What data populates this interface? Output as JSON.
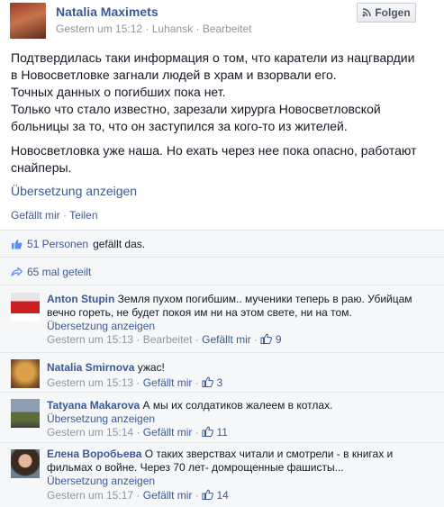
{
  "post": {
    "author": "Natalia Maximets",
    "time": "Gestern um 15:12",
    "sep": "·",
    "location": "Luhansk",
    "edited": "Bearbeitet",
    "follow_label": "Folgen",
    "body_lines": [
      "Подтвердилась таки информация о том, что каратели из нацгвардии",
      "в Новосветловке загнали людей в храм и взорвали его.",
      "Точных данных о погибших пока нет.",
      "Только что стало известно, зарезали хирурга Новосветловской",
      "больницы за то, что он заступился за кого-то из жителей."
    ],
    "body_lines_2": [
      "Новосветловка уже наша. Но ехать через нее пока опасно, работают",
      "снайперы."
    ],
    "translate_label": "Übersetzung anzeigen",
    "like_label": "Gefällt mir",
    "share_label": "Teilen"
  },
  "ufi": {
    "likes_link": "51 Personen",
    "likes_suffix": "gefällt das.",
    "shares_label": "65 mal geteilt"
  },
  "comments": [
    {
      "name": "Anton Stupin",
      "text_line1": "Земля пухом погибшим.. мученики теперь в раю. Убийцам",
      "text_line2": "вечно гореть, не будет покоя им ни на этом свете, ни на том.",
      "translate": "Übersetzung anzeigen",
      "time": "Gestern um 15:13",
      "edited": "Bearbeitet",
      "like": "Gefällt mir",
      "count": "9"
    },
    {
      "name": "Natalia Smirnova",
      "text_line1": "ужас!",
      "time": "Gestern um 15:13",
      "like": "Gefällt mir",
      "count": "3"
    },
    {
      "name": "Tatyana Makarova",
      "text_line1": "А мы их солдатиков жалеем в котлах.",
      "translate": "Übersetzung anzeigen",
      "time": "Gestern um 15:14",
      "like": "Gefällt mir",
      "count": "11"
    },
    {
      "name": "Елена Воробьева",
      "text_line1": "О таких зверствах читали и смотрели - в книгах и",
      "text_line2": "фильмах о войне. Через 70 лет- домрощенные фашисты...",
      "translate": "Übersetzung anzeigen",
      "time": "Gestern um 15:17",
      "like": "Gefällt mir",
      "count": "14"
    }
  ],
  "colors": {
    "link": "#3b5998",
    "meta": "#90949c",
    "ufi_bg": "#f6f7f8"
  },
  "icons": [
    "rss-icon",
    "thumbs-up-icon",
    "share-arrow-icon"
  ]
}
